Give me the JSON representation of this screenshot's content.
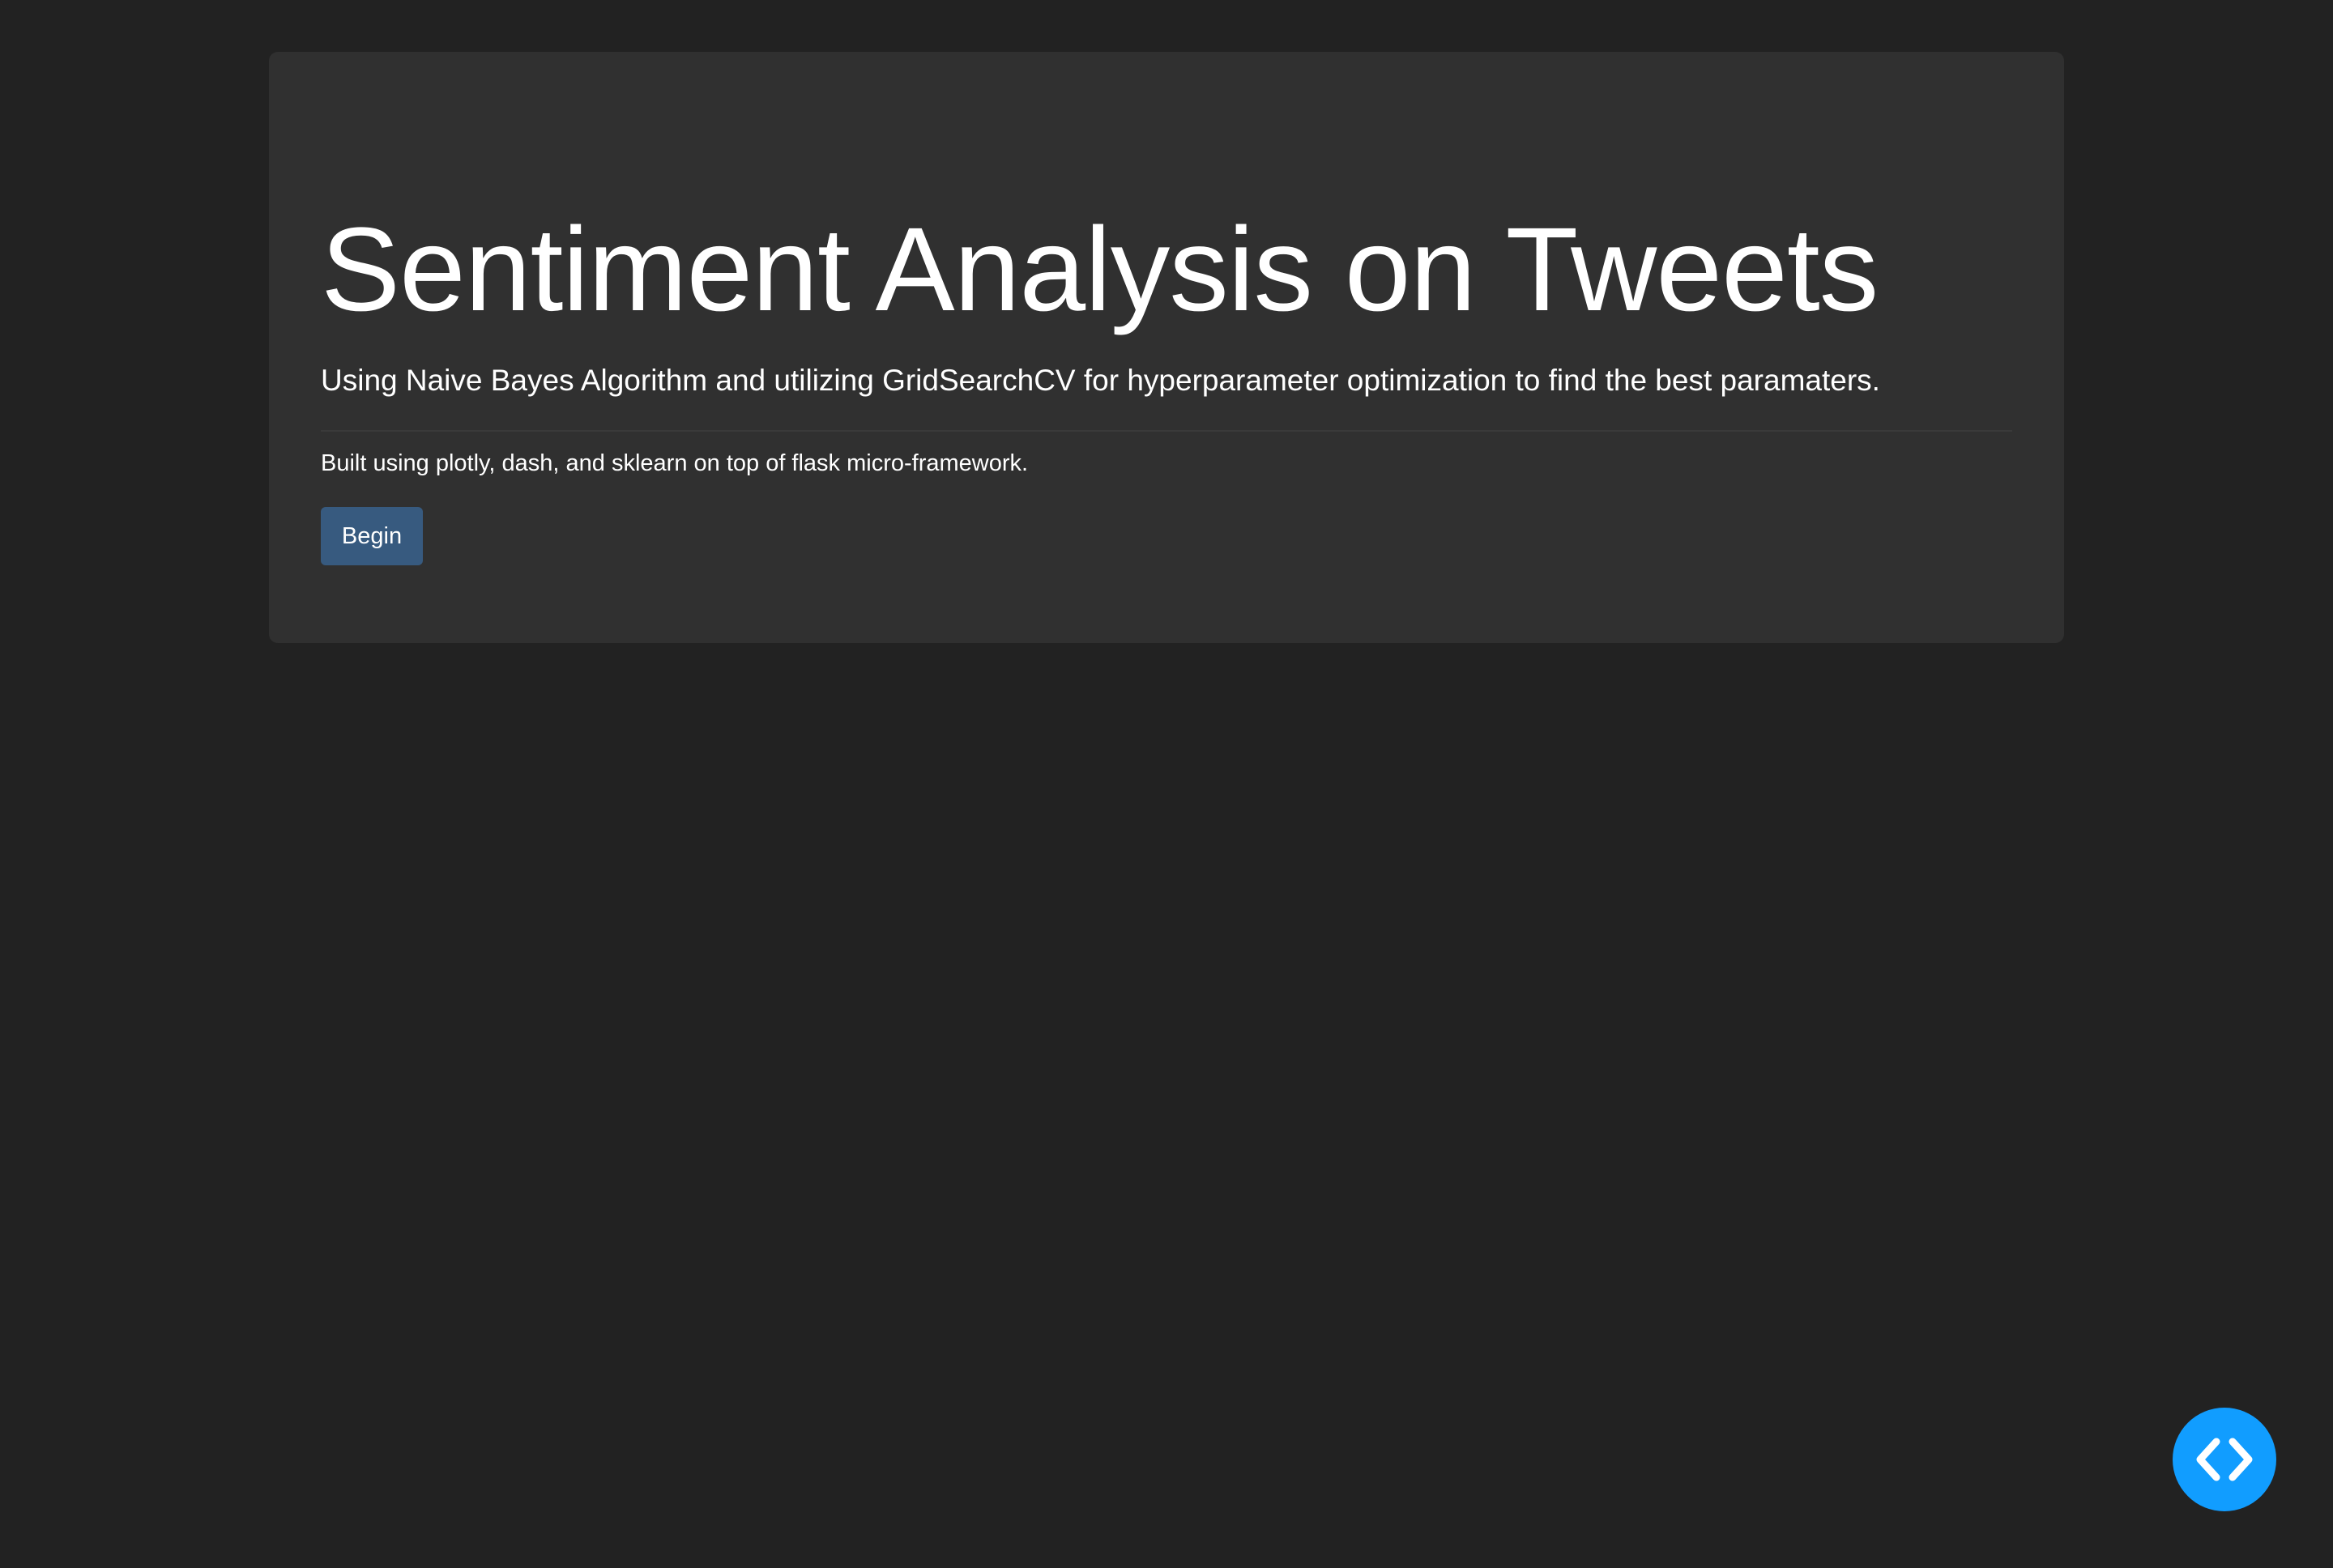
{
  "jumbotron": {
    "title": "Sentiment Analysis on Tweets",
    "lead": "Using Naive Bayes Algorithm and utilizing GridSearchCV for hyperparameter optimization to find the best paramaters.",
    "built_with": "Built using plotly, dash, and sklearn on top of flask micro-framework.",
    "begin_label": "Begin"
  },
  "debug_button": {
    "icon": "code-icon"
  },
  "colors": {
    "page_background": "#222222",
    "card_background": "#303030",
    "primary_button": "#375a7f",
    "fab_background": "#119dff",
    "text": "#ffffff"
  }
}
